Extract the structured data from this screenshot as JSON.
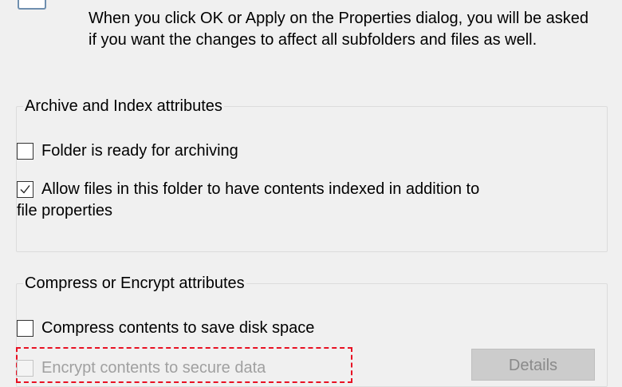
{
  "info": {
    "icon": "properties-icon",
    "text": "When you click OK or Apply on the Properties dialog, you will be asked if you want the changes to affect all subfolders and files as well."
  },
  "archive_group": {
    "title": "Archive and Index attributes",
    "options": [
      {
        "label": "Folder is ready for archiving",
        "checked": false
      },
      {
        "label_line1": "Allow files in this folder to have contents indexed in addition to",
        "label_line2": "file properties",
        "checked": true
      }
    ]
  },
  "compress_group": {
    "title": "Compress or Encrypt attributes",
    "options": [
      {
        "label": "Compress contents to save disk space",
        "checked": false
      },
      {
        "label": "Encrypt contents to secure data",
        "checked": false,
        "disabled": true
      }
    ],
    "details_button": "Details"
  },
  "colors": {
    "focus_outline": "#e81123",
    "disabled_text": "#a0a0a0"
  }
}
